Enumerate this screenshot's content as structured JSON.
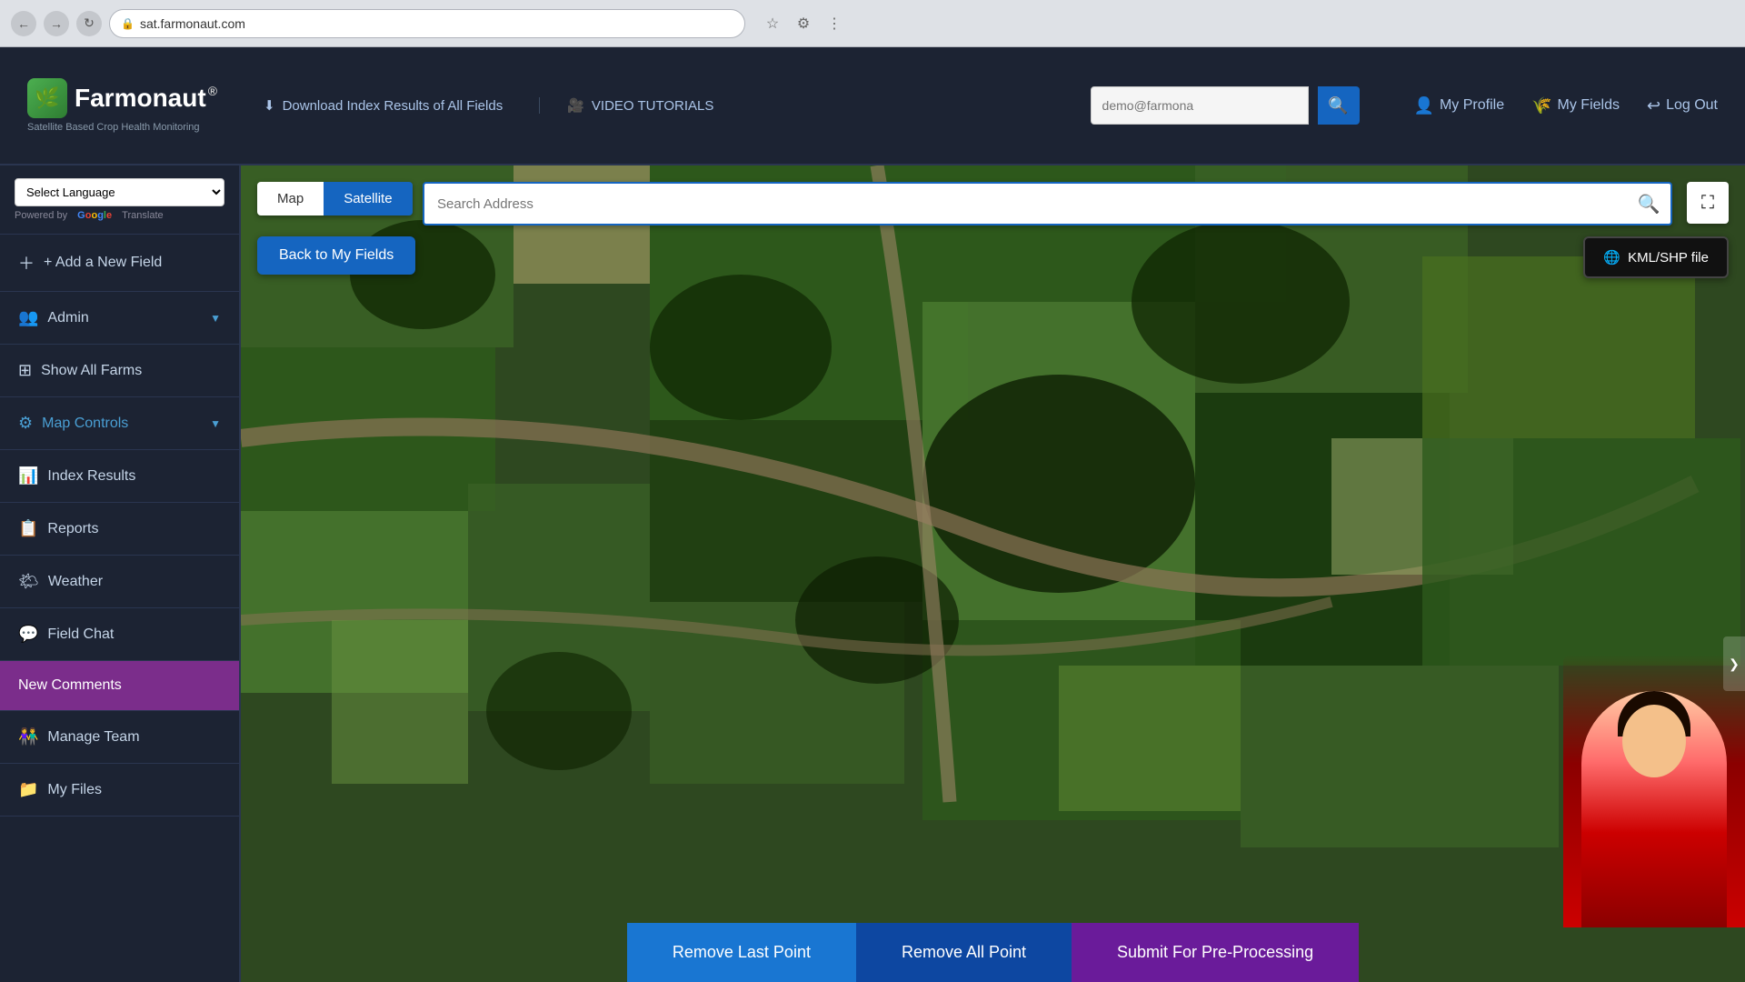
{
  "browser": {
    "url": "sat.farmonaut.com",
    "back_title": "Back",
    "forward_title": "Forward",
    "refresh_title": "Refresh"
  },
  "header": {
    "logo_text": "Farmonaut",
    "logo_reg": "®",
    "logo_subtitle": "Satellite Based Crop Health Monitoring",
    "download_label": "Download Index Results of All Fields",
    "tutorials_label": "VIDEO TUTORIALS",
    "search_placeholder": "demo@farmona",
    "nav": {
      "my_profile": "My Profile",
      "my_fields": "My Fields",
      "log_out": "Log Out"
    }
  },
  "sidebar": {
    "translate_label": "Select Language",
    "powered_by": "Powered by",
    "google_label": "Google",
    "translate_text": "Translate",
    "add_field_label": "+ Add a New Field",
    "admin_label": "Admin",
    "show_all_farms_label": "Show All Farms",
    "map_controls_label": "Map Controls",
    "index_results_label": "Index Results",
    "reports_label": "Reports",
    "weather_label": "Weather",
    "field_chat_label": "Field Chat",
    "new_comments_label": "New Comments",
    "manage_team_label": "Manage Team",
    "my_files_label": "My Files"
  },
  "map": {
    "map_btn": "Map",
    "satellite_btn": "Satellite",
    "search_placeholder": "Search Address",
    "back_btn": "Back to My Fields",
    "kml_label": "KML/SHP file",
    "remove_last_label": "Remove Last Point",
    "remove_all_label": "Remove All Point",
    "submit_label": "Submit For Pre-Processing"
  },
  "icons": {
    "search": "🔍",
    "download": "⬇",
    "video": "🎥",
    "profile": "👤",
    "fields": "🌾",
    "logout": "↩",
    "add": "+",
    "admin": "👥",
    "farms": "🏠",
    "controls": "⚙",
    "index": "📊",
    "reports": "📋",
    "weather": "🌤",
    "chat": "💬",
    "team": "👫",
    "files": "📁",
    "kml": "🌐",
    "fullscreen": "⛶",
    "arrow_right": "❯"
  }
}
